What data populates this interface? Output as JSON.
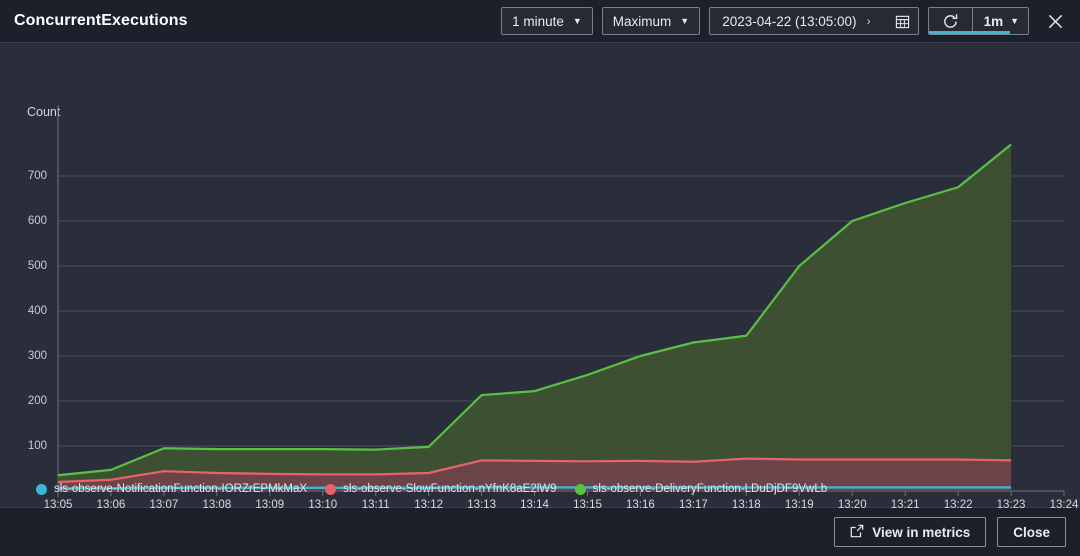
{
  "header": {
    "title": "ConcurrentExecutions",
    "period": "1 minute",
    "statistic": "Maximum",
    "range_start": "2023-04-22 (13:05:00)",
    "range_separator": "›",
    "calendar_icon": "calendar-icon",
    "refresh_icon": "refresh-icon",
    "interval": "1m",
    "close_icon": "close-icon",
    "caret": "▼"
  },
  "footer": {
    "view_in_metrics": "View in metrics",
    "external_link_icon": "external-link-icon",
    "close": "Close"
  },
  "colors": {
    "notification": "#3ab7d8",
    "slow": "#e8616d",
    "delivery": "#5ac044",
    "slow_fill": "#6b4449",
    "delivery_fill": "#3d5132",
    "grid": "#4a4f5c",
    "background": "#2a2e3a",
    "header_background": "#1b202b",
    "accent": "#3ab7d8"
  },
  "chart_data": {
    "type": "area",
    "title": "ConcurrentExecutions",
    "ylabel": "Count",
    "xlabel": "",
    "ylim": [
      0,
      800
    ],
    "yticks": [
      0,
      100,
      200,
      300,
      400,
      500,
      600,
      700
    ],
    "grid": true,
    "legend_position": "bottom-left",
    "stacked": false,
    "x": [
      "13:05",
      "13:06",
      "13:07",
      "13:08",
      "13:09",
      "13:10",
      "13:11",
      "13:12",
      "13:13",
      "13:14",
      "13:15",
      "13:16",
      "13:17",
      "13:18",
      "13:19",
      "13:20",
      "13:21",
      "13:22",
      "13:23",
      "13:24"
    ],
    "series": [
      {
        "name": "sls-observe-NotificationFunction-IORZrEPMkMaX",
        "color": "#3ab7d8",
        "values": [
          6,
          6,
          7,
          7,
          7,
          7,
          7,
          7,
          8,
          8,
          8,
          8,
          8,
          8,
          8,
          8,
          8,
          8,
          8,
          null
        ]
      },
      {
        "name": "sls-observe-SlowFunction-nYfnK8aE2lW9",
        "color": "#e8616d",
        "values": [
          20,
          25,
          44,
          40,
          38,
          37,
          37,
          40,
          68,
          67,
          66,
          67,
          65,
          72,
          70,
          70,
          70,
          70,
          68,
          null
        ]
      },
      {
        "name": "sls-observe-DeliveryFunction-LDuDjDF9VwLb",
        "color": "#5ac044",
        "values": [
          35,
          47,
          95,
          93,
          93,
          93,
          92,
          98,
          213,
          222,
          258,
          300,
          330,
          345,
          500,
          600,
          640,
          675,
          770,
          null
        ]
      }
    ]
  }
}
